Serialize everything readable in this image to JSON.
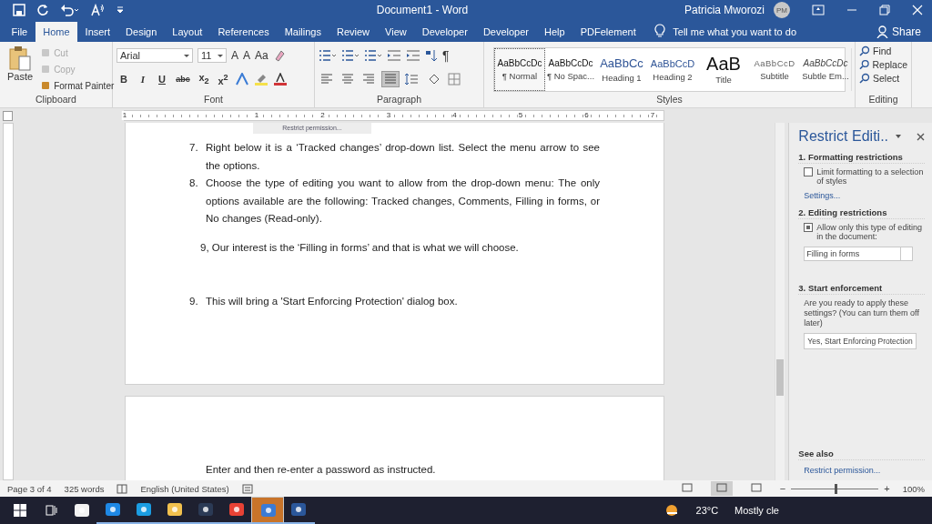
{
  "title_bar": {
    "title": "Document1 - Word",
    "user": "Patricia Mworozi",
    "initials": "PM"
  },
  "tabs": [
    {
      "label": "File",
      "selected": false
    },
    {
      "label": "Home",
      "selected": true
    },
    {
      "label": "Insert",
      "selected": false
    },
    {
      "label": "Design",
      "selected": false
    },
    {
      "label": "Layout",
      "selected": false
    },
    {
      "label": "References",
      "selected": false
    },
    {
      "label": "Mailings",
      "selected": false
    },
    {
      "label": "Review",
      "selected": false
    },
    {
      "label": "View",
      "selected": false
    },
    {
      "label": "Developer",
      "selected": false
    },
    {
      "label": "Developer",
      "selected": false
    },
    {
      "label": "Help",
      "selected": false
    },
    {
      "label": "PDFelement",
      "selected": false
    }
  ],
  "tell_me": "Tell me what you want to do",
  "share": "Share",
  "clipboard": {
    "label": "Clipboard",
    "paste": "Paste",
    "items": [
      {
        "label": "Cut",
        "disabled": true
      },
      {
        "label": "Copy",
        "disabled": true
      },
      {
        "label": "Format Painter",
        "disabled": false
      }
    ]
  },
  "font": {
    "label": "Font",
    "name": "Arial",
    "size": "11",
    "top_buttons": [
      "A",
      "A",
      "Aa"
    ],
    "format_buttons": [
      "B",
      "I",
      "U",
      "abc",
      "x$_{2}$",
      "x$^{2}$"
    ]
  },
  "paragraph": {
    "label": "Paragraph",
    "pilcrow": "¶",
    "alignments": [
      {
        "selected": false
      },
      {
        "selected": false
      },
      {
        "selected": false
      },
      {
        "selected": true
      }
    ]
  },
  "styles": {
    "label": "Styles",
    "items": [
      {
        "preview": "AaBbCcDc",
        "name": "¶ Normal",
        "kind": "normal",
        "selected": true
      },
      {
        "preview": "AaBbCcDc",
        "name": "¶ No Spac...",
        "kind": "nospacing",
        "selected": false
      },
      {
        "preview": "AaBbCc",
        "name": "Heading 1",
        "kind": "heading1",
        "selected": false
      },
      {
        "preview": "AaBbCcD",
        "name": "Heading 2",
        "kind": "heading2",
        "selected": false
      },
      {
        "preview": "AaB",
        "name": "Title",
        "kind": "title",
        "selected": false
      },
      {
        "preview": "AaBbCcD",
        "name": "Subtitle",
        "kind": "subtitle",
        "selected": false
      },
      {
        "preview": "AaBbCcDc",
        "name": "Subtle Em...",
        "kind": "emphasis",
        "selected": false
      }
    ]
  },
  "editing": {
    "label": "Editing",
    "items": [
      "Find",
      "Replace",
      "Select"
    ]
  },
  "ruler": {
    "numbers": [
      "1",
      "1",
      "2",
      "3",
      "4",
      "5",
      "6",
      "7"
    ]
  },
  "tooltip": "Restrict permission...",
  "document": {
    "page1": [
      {
        "kind": "numbered",
        "number": "7.",
        "text": "Right below it is a ‘Tracked changes’ drop-down list. Select the menu arrow to see the options."
      },
      {
        "kind": "numbered",
        "number": "8.",
        "text": "Choose the type of editing you want to allow from the drop-down menu: The only options available are the following: Tracked changes, Comments, Filling in forms, or No changes (Read-only)."
      },
      {
        "kind": "plain",
        "text": "9, Our interest is the ‘Filling in forms’ and that is what we will choose."
      },
      {
        "kind": "numbered",
        "number": "9.",
        "text": "This will bring a 'Start Enforcing Protection' dialog box."
      }
    ],
    "page2": [
      {
        "kind": "indented",
        "text": "Enter and then re-enter a password as instructed."
      }
    ]
  },
  "pane": {
    "title": "Restrict Editi..",
    "sections": [
      {
        "heading": "1. Formatting restrictions"
      },
      {
        "heading": "2. Editing restrictions"
      },
      {
        "heading": "3. Start enforcement"
      }
    ],
    "formatting": {
      "label": "Limit formatting to a selection of styles",
      "checked": false,
      "link": "Settings..."
    },
    "editing": {
      "label": "Allow only this type of editing in the document:",
      "checked": true,
      "value": "Filling in forms"
    },
    "enforcement": {
      "text": "Are you ready to apply these settings? (You can turn them off later)",
      "button": "Yes, Start Enforcing Protection"
    },
    "see_also": {
      "heading": "See also",
      "link": "Restrict permission..."
    }
  },
  "status_bar": {
    "page": "Page 3 of 4",
    "words": "325 words",
    "language": "English (United States)",
    "views": [
      {
        "selected": false
      },
      {
        "selected": true
      },
      {
        "selected": false
      }
    ],
    "zoom_out": "−",
    "zoom_in": "+",
    "zoom": {
      "level": 0.5
    },
    "zoom_text": "100%"
  },
  "taskbar": {
    "apps": [
      {
        "kind": "store",
        "open": false,
        "selected": false
      },
      {
        "kind": "mail",
        "open": true,
        "selected": false
      },
      {
        "kind": "edge",
        "open": true,
        "selected": false
      },
      {
        "kind": "explorer",
        "open": true,
        "selected": false
      },
      {
        "kind": "calculator",
        "open": true,
        "selected": false
      },
      {
        "kind": "chrome",
        "open": true,
        "selected": false
      },
      {
        "kind": "app",
        "open": true,
        "selected": true
      },
      {
        "kind": "word",
        "open": true,
        "selected": false
      }
    ],
    "weather": {
      "temp": "23°C",
      "text": "Mostly cle"
    }
  }
}
